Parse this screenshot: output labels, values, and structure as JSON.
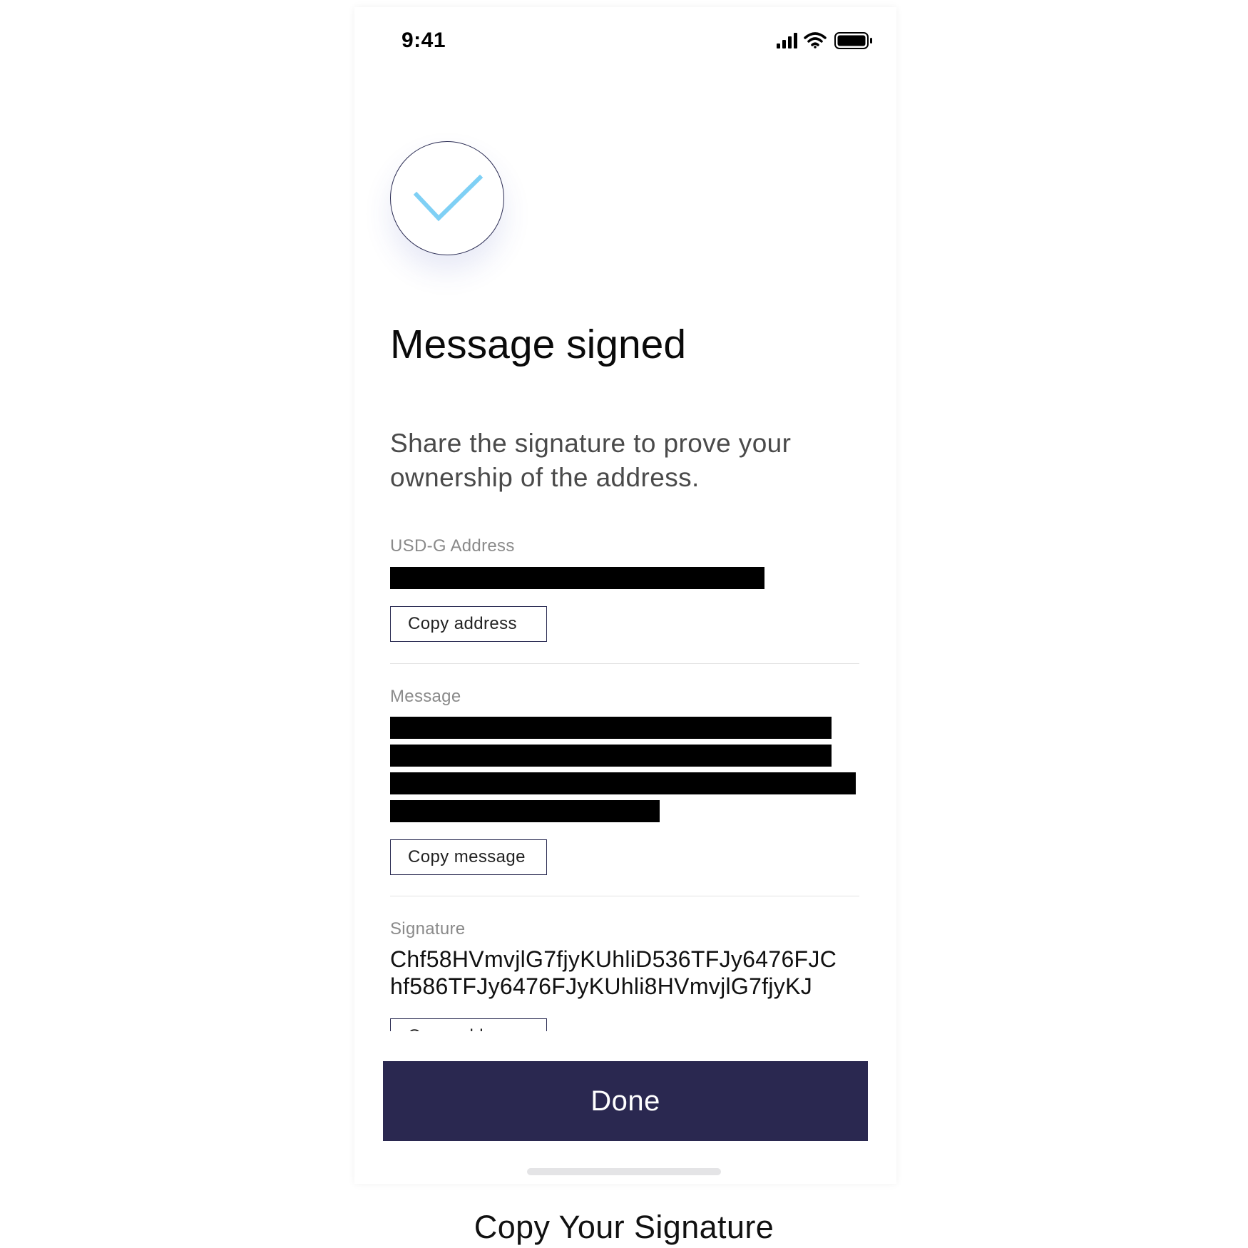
{
  "status_bar": {
    "time": "9:41",
    "icons": [
      "signal-icon",
      "wifi-icon",
      "battery-icon"
    ]
  },
  "success_icon": "checkmark-icon",
  "colors": {
    "primary": "#2a2850",
    "check": "#7fd0f5",
    "label": "#8a8a8a"
  },
  "title": "Message signed",
  "description": "Share the signature to prove your ownership of the address.",
  "address_section": {
    "label": "USD-G Address",
    "value_redacted": true,
    "copy_label": "Copy address"
  },
  "message_section": {
    "label": "Message",
    "value_redacted": true,
    "copy_label": "Copy message"
  },
  "signature_section": {
    "label": "Signature",
    "line1": "Chf58HVmvjlG7fjyKUhliD536TFJy6476FJC",
    "line2": "hf586TFJy6476FJyKUhli8HVmvjlG7fjyKJ",
    "copy_label": "Copy address"
  },
  "done_label": "Done",
  "caption": "Copy Your Signature"
}
